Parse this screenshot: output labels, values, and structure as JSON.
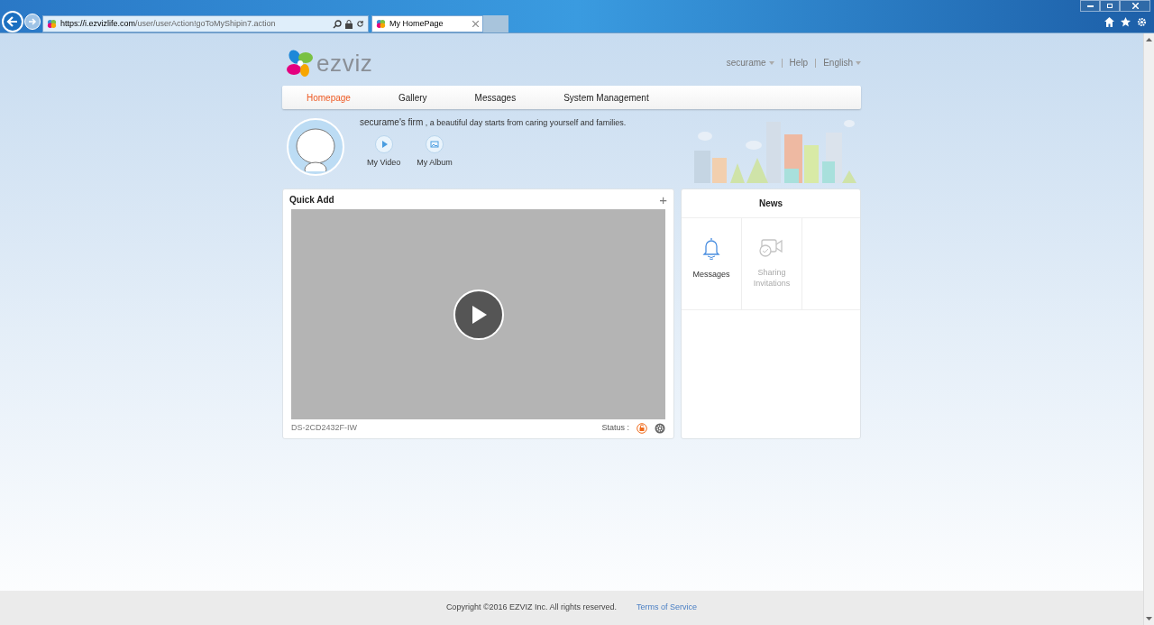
{
  "browser": {
    "url_host": "https://i.ezvizlife.com",
    "url_path": "/user/userAction!goToMyShipin7.action",
    "tabs": [
      {
        "title": "My HomePage",
        "selected": true
      }
    ]
  },
  "header": {
    "logo_text": "ezviz",
    "user_menu": "securame",
    "help": "Help",
    "language": "English"
  },
  "nav": [
    {
      "label": "Homepage",
      "selected": true
    },
    {
      "label": "Gallery",
      "selected": false
    },
    {
      "label": "Messages",
      "selected": false
    },
    {
      "label": "System Management",
      "selected": false
    }
  ],
  "profile": {
    "name": "securame's firm",
    "motto": " , a beautiful day starts from caring yourself and families.",
    "links": [
      {
        "kind": "video",
        "label": "My Video"
      },
      {
        "kind": "album",
        "label": "My Album"
      }
    ]
  },
  "quick_add": {
    "title": "Quick Add",
    "add": "+",
    "device": "DS-2CD2432F-IW",
    "status_label": "Status :"
  },
  "news": {
    "title": "News",
    "items": [
      {
        "kind": "bell",
        "label": "Messages",
        "disabled": false
      },
      {
        "kind": "share",
        "label": "Sharing Invitations",
        "disabled": true
      }
    ]
  },
  "footer": {
    "copyright": "Copyright ©2016 EZVIZ Inc. All rights reserved.",
    "terms": "Terms of Service"
  }
}
